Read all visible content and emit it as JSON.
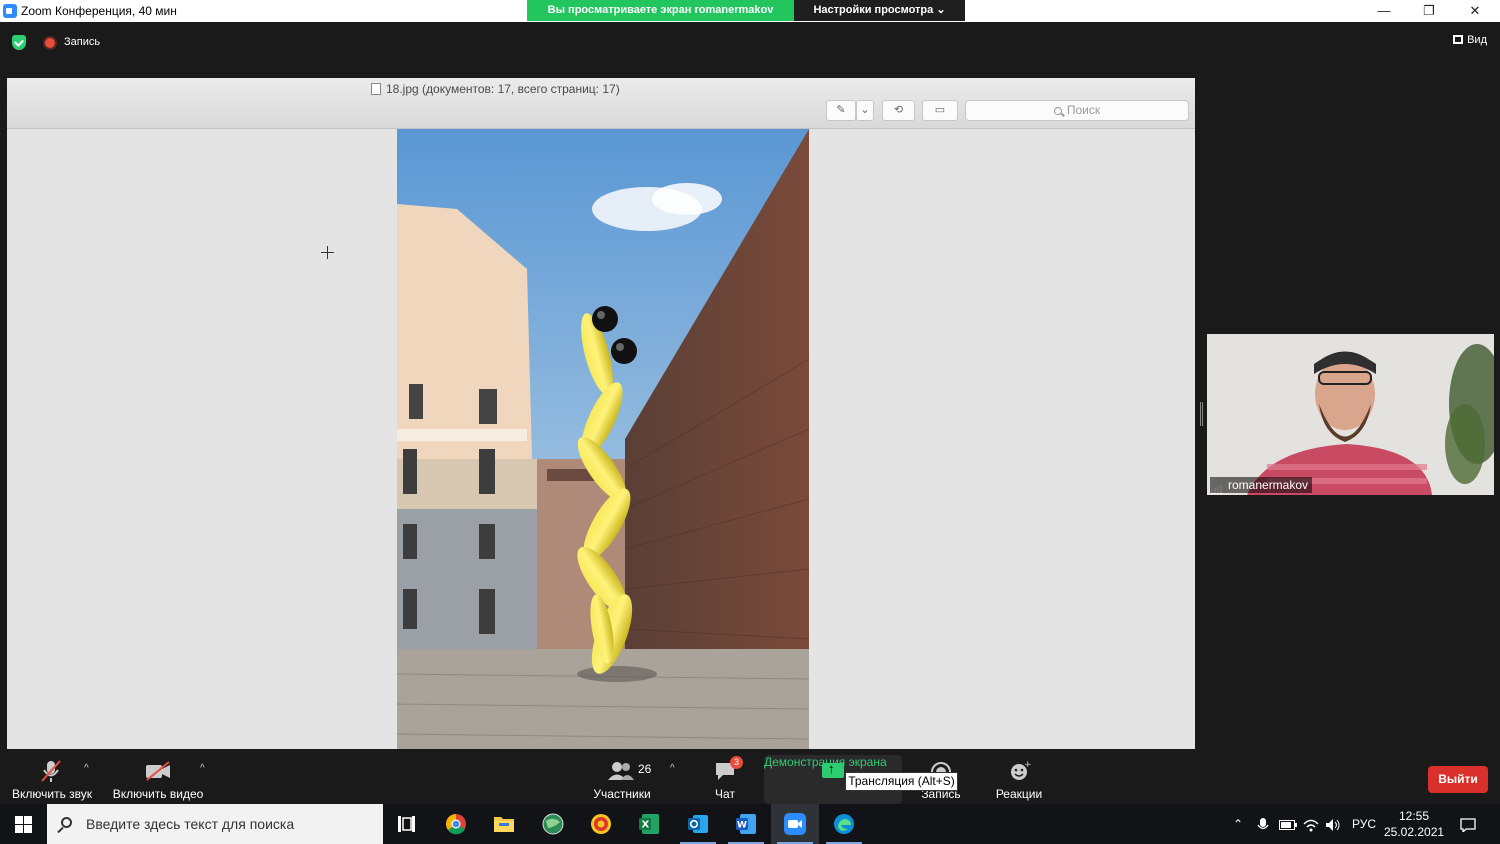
{
  "window": {
    "title": "Zoom Конференция, 40 мин",
    "share_banner": "Вы просматриваете экран romanermakov",
    "view_settings": "Настройки просмотра ⌄",
    "minimize": "—",
    "restore": "❐",
    "close": "✕"
  },
  "topbar": {
    "recording_label": "Запись",
    "view_label": "Вид"
  },
  "viewer": {
    "doc_title": "18.jpg (документов: 17, всего страниц: 17)",
    "search_placeholder": "Поиск"
  },
  "participant": {
    "name": "romanermakov"
  },
  "toolbar": {
    "mute_label": "Включить звук",
    "video_label": "Включить видео",
    "participants_label": "Участники",
    "participants_count": "26",
    "chat_label": "Чат",
    "chat_badge": "3",
    "share_label": "Демонстрация экрана",
    "share_tooltip": "Трансляция (Alt+S)",
    "record_label": "Запись",
    "reactions_label": "Реакции",
    "leave_label": "Выйти"
  },
  "taskbar": {
    "search_placeholder": "Введите здесь текст для поиска",
    "language": "РУС",
    "time": "12:55",
    "date": "25.02.2021"
  },
  "colors": {
    "zoom_green": "#23c55e",
    "leave_red": "#d9302b",
    "chat_badge": "#e74c3c"
  }
}
